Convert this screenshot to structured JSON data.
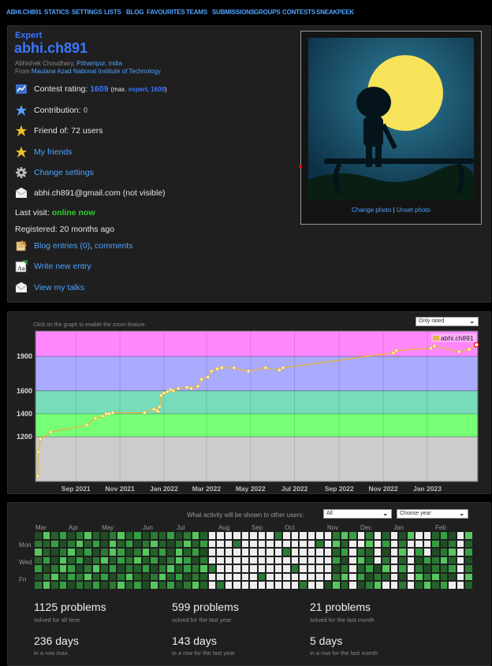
{
  "nav": [
    "ABHI.CH891",
    "STATICS",
    "SETTINGS",
    "LISTS",
    "BLOG",
    "FAVOURITES",
    "TEAMS",
    "SUBMISSIONS",
    "GROUPS",
    "CONTESTS",
    "SNEAKPEEK"
  ],
  "profile": {
    "rank": "Expert",
    "handle": "abhi.ch891",
    "name": "Abhishek Choudhary",
    "city": "Pithampur",
    "country": "India",
    "from_label": "From",
    "org": "Maulana Azad National Institute of Technology",
    "rating_label": "Contest rating:",
    "rating": "1609",
    "max_prefix": "(max.",
    "max_rank": "expert,",
    "max_rating": "1609",
    "max_suffix": ")",
    "contribution_label": "Contribution:",
    "contribution": "0",
    "friend_of": "Friend of: 72 users",
    "my_friends": "My friends",
    "change_settings": "Change settings",
    "email": "abhi.ch891@gmail.com (not visible)",
    "last_visit_label": "Last visit:",
    "last_visit": "online now",
    "registered": "Registered: 20 months ago",
    "blog_entries": "Blog entries (0)",
    "comments": "comments",
    "write_entry": "Write new entry",
    "talks": "View my talks",
    "change_photo": "Change photo",
    "sep": "|",
    "unset_photo": "Unset photo"
  },
  "colors": {
    "link": "#4da3ff",
    "expert": "#3b76ff",
    "online": "#2fd12f",
    "line": "#e3b83a"
  },
  "chart_hint": "Click on the graph to enable the zoom feature.",
  "chart_select": "Only rated",
  "chart_data": {
    "type": "line",
    "title": "",
    "series": [
      {
        "name": "abhi.ch891",
        "x": [
          "2021-07-10",
          "2021-07-11",
          "2021-07-14",
          "2021-07-28",
          "2021-09-16",
          "2021-09-28",
          "2021-10-08",
          "2021-10-13",
          "2021-10-17",
          "2021-10-22",
          "2021-12-05",
          "2021-12-18",
          "2021-12-22",
          "2021-12-24",
          "2021-12-26",
          "2021-12-28",
          "2022-01-01",
          "2022-01-06",
          "2022-01-10",
          "2022-01-14",
          "2022-01-21",
          "2022-02-02",
          "2022-02-08",
          "2022-02-17",
          "2022-02-22",
          "2022-03-03",
          "2022-03-08",
          "2022-03-16",
          "2022-03-22",
          "2022-04-08",
          "2022-04-28",
          "2022-05-22",
          "2022-06-10",
          "2022-06-15",
          "2022-11-15",
          "2022-11-19",
          "2023-01-06",
          "2023-01-11",
          "2023-02-14",
          "2023-02-28",
          "2023-03-10"
        ],
        "values": [
          860,
          1070,
          1180,
          1240,
          1300,
          1360,
          1380,
          1400,
          1400,
          1410,
          1410,
          1440,
          1430,
          1420,
          1460,
          1560,
          1580,
          1590,
          1610,
          1600,
          1620,
          1630,
          1620,
          1640,
          1700,
          1720,
          1770,
          1790,
          1800,
          1800,
          1770,
          1800,
          1780,
          1800,
          1930,
          1950,
          1970,
          1990,
          1940,
          1960,
          2000
        ]
      }
    ],
    "y_ticks": [
      1200,
      1400,
      1600,
      1900
    ],
    "x_ticks": [
      "Sep 2021",
      "Nov 2021",
      "Jan 2022",
      "Mar 2022",
      "May 2022",
      "Jul 2022",
      "Sep 2022",
      "Nov 2022",
      "Jan 2023"
    ],
    "ylim": [
      810,
      2120
    ],
    "bands": [
      {
        "from": 810,
        "to": 1200,
        "color": "#cccccc"
      },
      {
        "from": 1200,
        "to": 1400,
        "color": "#77ff77"
      },
      {
        "from": 1400,
        "to": 1600,
        "color": "#77ddbb"
      },
      {
        "from": 1600,
        "to": 1900,
        "color": "#aaaaff"
      },
      {
        "from": 1900,
        "to": 2120,
        "color": "#ff88ff"
      }
    ]
  },
  "activity": {
    "label": "What activity will be shown to other users:",
    "select_value": "All",
    "year_select": "Choose year",
    "months": [
      "Mar",
      "Apr",
      "May",
      "Jun",
      "Jul",
      "Aug",
      "Sep",
      "Oct",
      "Nov",
      "Dec",
      "Jan",
      "Feb"
    ],
    "days": [
      "Mon",
      "Wed",
      "Fri"
    ]
  },
  "stats": [
    {
      "big": "1125 problems",
      "small": "solved for all time"
    },
    {
      "big": "599 problems",
      "small": "solved for the last year"
    },
    {
      "big": "21 problems",
      "small": "solved for the last month"
    },
    {
      "big": "236 days",
      "small": "in a row max."
    },
    {
      "big": "143 days",
      "small": "in a row for the last year"
    },
    {
      "big": "5 days",
      "small": "in a row for the last month"
    }
  ]
}
